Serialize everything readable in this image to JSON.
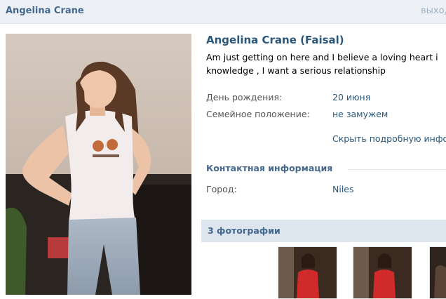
{
  "header": {
    "name": "Angelina Crane",
    "exit_label": "выход"
  },
  "profile": {
    "full_name": "Angelina Crane (Faisal)",
    "status_line1": "Am just getting on here and I believe a loving heart i",
    "status_line2": "knowledge , I want a serious relationship"
  },
  "details": {
    "birthday_label": "День рождения:",
    "birthday_value": "20 июня",
    "relationship_label": "Семейное положение:",
    "relationship_value": "не замужем",
    "hide_details": "Скрыть подробную инфо"
  },
  "contact": {
    "section_title": "Контактная информация",
    "city_label": "Город:",
    "city_value": "Niles"
  },
  "photos": {
    "section_title": "3 фотографии"
  },
  "colors": {
    "link": "#2b587a",
    "header_bg": "#edf1f5",
    "section_bar": "#dde6ee"
  }
}
